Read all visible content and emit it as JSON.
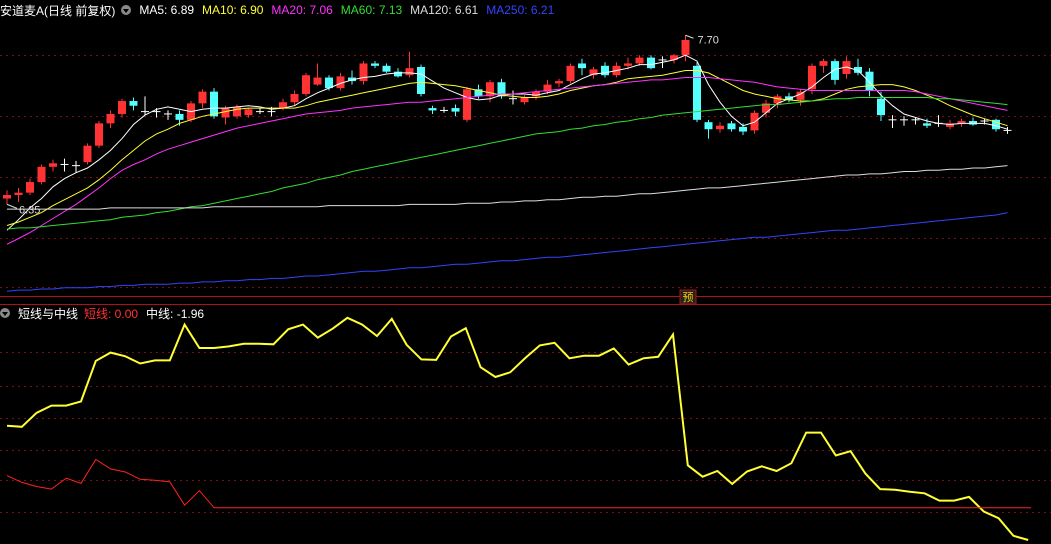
{
  "header": {
    "title": "安道麦A(日线 前复权)",
    "ma": [
      {
        "label": "MA5: 6.89",
        "color": "#ffffff"
      },
      {
        "label": "MA10: 6.90",
        "color": "#ffff33"
      },
      {
        "label": "MA20: 7.06",
        "color": "#ff33ff"
      },
      {
        "label": "MA60: 7.13",
        "color": "#33dd33"
      },
      {
        "label": "MA120: 6.61",
        "color": "#dddddd"
      },
      {
        "label": "MA250: 6.21",
        "color": "#3344ff"
      }
    ]
  },
  "indicator_header": {
    "title": "短线与中线",
    "items": [
      {
        "label": "短线: 0.00",
        "color": "#ff3333"
      },
      {
        "label": "中线: -1.96",
        "color": "#ffffff"
      }
    ]
  },
  "chart_data": [
    {
      "type": "candlestick",
      "title": "安道麦A(日线 前复权)",
      "annotations": {
        "high_label": "7.70",
        "low_label": "6.35",
        "marker": "预"
      },
      "colors": {
        "up": "#ff3333",
        "down": "#54ffff",
        "doji": "#ffffff"
      },
      "ylim": [
        5.5,
        7.85
      ],
      "candles": [
        [
          6.33,
          6.4,
          6.28,
          6.36
        ],
        [
          6.36,
          6.42,
          6.3,
          6.38
        ],
        [
          6.38,
          6.5,
          6.36,
          6.47
        ],
        [
          6.47,
          6.62,
          6.45,
          6.6
        ],
        [
          6.6,
          6.66,
          6.56,
          6.63
        ],
        [
          6.62,
          6.67,
          6.56,
          6.61
        ],
        [
          6.61,
          6.65,
          6.55,
          6.6
        ],
        [
          6.64,
          6.8,
          6.62,
          6.78
        ],
        [
          6.78,
          6.99,
          6.76,
          6.97
        ],
        [
          6.97,
          7.08,
          6.93,
          7.05
        ],
        [
          7.05,
          7.18,
          7.02,
          7.16
        ],
        [
          7.16,
          7.19,
          7.08,
          7.12
        ],
        [
          7.07,
          7.2,
          7.04,
          7.06
        ],
        [
          7.06,
          7.1,
          7.02,
          7.07
        ],
        [
          7.05,
          7.08,
          7.0,
          7.05
        ],
        [
          7.05,
          7.08,
          6.95,
          7.0
        ],
        [
          7.0,
          7.16,
          6.98,
          7.14
        ],
        [
          7.14,
          7.26,
          7.1,
          7.24
        ],
        [
          7.24,
          7.27,
          7.01,
          7.03
        ],
        [
          7.02,
          7.12,
          6.96,
          7.1
        ],
        [
          7.03,
          7.13,
          7.01,
          7.11
        ],
        [
          7.04,
          7.1,
          7.02,
          7.09
        ],
        [
          7.06,
          7.1,
          7.05,
          7.07
        ],
        [
          7.07,
          7.11,
          7.03,
          7.06
        ],
        [
          7.1,
          7.18,
          7.08,
          7.15
        ],
        [
          7.15,
          7.25,
          7.12,
          7.22
        ],
        [
          7.22,
          7.4,
          7.2,
          7.38
        ],
        [
          7.3,
          7.48,
          7.29,
          7.36
        ],
        [
          7.36,
          7.38,
          7.25,
          7.27
        ],
        [
          7.27,
          7.4,
          7.25,
          7.37
        ],
        [
          7.36,
          7.42,
          7.3,
          7.33
        ],
        [
          7.33,
          7.5,
          7.3,
          7.48
        ],
        [
          7.48,
          7.5,
          7.44,
          7.46
        ],
        [
          7.46,
          7.48,
          7.4,
          7.41
        ],
        [
          7.41,
          7.44,
          7.36,
          7.37
        ],
        [
          7.38,
          7.58,
          7.36,
          7.44
        ],
        [
          7.45,
          7.47,
          7.2,
          7.22
        ],
        [
          7.1,
          7.12,
          7.05,
          7.08
        ],
        [
          7.08,
          7.11,
          7.06,
          7.08
        ],
        [
          7.1,
          7.13,
          7.03,
          7.07
        ],
        [
          7.0,
          7.28,
          6.98,
          7.26
        ],
        [
          7.26,
          7.3,
          7.18,
          7.2
        ],
        [
          7.2,
          7.34,
          7.15,
          7.32
        ],
        [
          7.32,
          7.35,
          7.18,
          7.2
        ],
        [
          7.18,
          7.25,
          7.13,
          7.17
        ],
        [
          7.15,
          7.21,
          7.13,
          7.19
        ],
        [
          7.2,
          7.26,
          7.17,
          7.24
        ],
        [
          7.24,
          7.34,
          7.22,
          7.3
        ],
        [
          7.31,
          7.35,
          7.28,
          7.33
        ],
        [
          7.33,
          7.48,
          7.31,
          7.46
        ],
        [
          7.48,
          7.52,
          7.38,
          7.44
        ],
        [
          7.38,
          7.45,
          7.35,
          7.43
        ],
        [
          7.46,
          7.49,
          7.36,
          7.38
        ],
        [
          7.38,
          7.49,
          7.36,
          7.46
        ],
        [
          7.46,
          7.53,
          7.43,
          7.48
        ],
        [
          7.48,
          7.55,
          7.46,
          7.53
        ],
        [
          7.53,
          7.55,
          7.43,
          7.44
        ],
        [
          7.5,
          7.54,
          7.44,
          7.51
        ],
        [
          7.51,
          7.56,
          7.48,
          7.55
        ],
        [
          7.55,
          7.72,
          7.5,
          7.68
        ],
        [
          7.46,
          7.49,
          6.98,
          7.0
        ],
        [
          6.98,
          7.0,
          6.84,
          6.92
        ],
        [
          6.92,
          6.98,
          6.89,
          6.95
        ],
        [
          6.97,
          6.99,
          6.9,
          6.92
        ],
        [
          6.94,
          6.97,
          6.87,
          6.9
        ],
        [
          6.91,
          7.08,
          6.88,
          7.06
        ],
        [
          7.06,
          7.17,
          7.02,
          7.14
        ],
        [
          7.14,
          7.22,
          7.1,
          7.2
        ],
        [
          7.2,
          7.23,
          7.15,
          7.17
        ],
        [
          7.17,
          7.26,
          7.12,
          7.24
        ],
        [
          7.26,
          7.48,
          7.22,
          7.46
        ],
        [
          7.46,
          7.52,
          7.4,
          7.5
        ],
        [
          7.5,
          7.52,
          7.3,
          7.34
        ],
        [
          7.39,
          7.54,
          7.35,
          7.5
        ],
        [
          7.45,
          7.52,
          7.38,
          7.4
        ],
        [
          7.41,
          7.44,
          7.2,
          7.25
        ],
        [
          7.18,
          7.24,
          6.99,
          7.04
        ],
        [
          7.0,
          7.04,
          6.93,
          7.0
        ],
        [
          7.0,
          7.03,
          6.95,
          7.0
        ],
        [
          7.0,
          7.02,
          6.96,
          7.0
        ],
        [
          6.97,
          7.01,
          6.93,
          6.95
        ],
        [
          6.97,
          7.04,
          6.94,
          6.96
        ],
        [
          6.94,
          7.0,
          6.92,
          6.97
        ],
        [
          6.97,
          7.01,
          6.94,
          6.99
        ],
        [
          6.99,
          7.02,
          6.95,
          6.96
        ],
        [
          6.98,
          7.01,
          6.96,
          6.99
        ],
        [
          7.0,
          7.01,
          6.9,
          6.92
        ],
        [
          6.9,
          6.94,
          6.88,
          6.91
        ]
      ],
      "ma": {
        "MA5": [
          6.06,
          6.15,
          6.25,
          6.33,
          6.43,
          6.5,
          6.55,
          6.59,
          6.66,
          6.74,
          6.84,
          6.96,
          7.04,
          7.09,
          7.11,
          7.09,
          7.07,
          7.09,
          7.1,
          7.1,
          7.11,
          7.12,
          7.11,
          7.09,
          7.1,
          7.12,
          7.18,
          7.23,
          7.27,
          7.31,
          7.34,
          7.36,
          7.37,
          7.39,
          7.4,
          7.4,
          7.39,
          7.33,
          7.27,
          7.23,
          7.19,
          7.17,
          7.18,
          7.21,
          7.22,
          7.22,
          7.21,
          7.23,
          7.25,
          7.3,
          7.35,
          7.39,
          7.4,
          7.42,
          7.44,
          7.47,
          7.47,
          7.49,
          7.51,
          7.55,
          7.5,
          7.3,
          7.15,
          7.03,
          6.95,
          6.98,
          7.06,
          7.14,
          7.18,
          7.22,
          7.28,
          7.36,
          7.43,
          7.45,
          7.42,
          7.32,
          7.21,
          7.12,
          7.05,
          7.02,
          6.99,
          6.97,
          6.96,
          6.97,
          6.97,
          6.97,
          6.95,
          6.92
        ],
        "MA10": [
          6.1,
          6.13,
          6.17,
          6.21,
          6.27,
          6.32,
          6.37,
          6.42,
          6.49,
          6.57,
          6.66,
          6.74,
          6.82,
          6.88,
          6.92,
          6.97,
          7.0,
          7.03,
          7.05,
          7.07,
          7.09,
          7.1,
          7.1,
          7.1,
          7.1,
          7.1,
          7.12,
          7.15,
          7.17,
          7.19,
          7.21,
          7.23,
          7.25,
          7.27,
          7.29,
          7.31,
          7.32,
          7.31,
          7.3,
          7.29,
          7.27,
          7.25,
          7.23,
          7.21,
          7.2,
          7.19,
          7.19,
          7.2,
          7.22,
          7.25,
          7.27,
          7.29,
          7.3,
          7.32,
          7.35,
          7.36,
          7.37,
          7.38,
          7.4,
          7.42,
          7.42,
          7.4,
          7.35,
          7.3,
          7.25,
          7.22,
          7.2,
          7.18,
          7.17,
          7.16,
          7.16,
          7.18,
          7.22,
          7.26,
          7.28,
          7.29,
          7.3,
          7.3,
          7.28,
          7.25,
          7.21,
          7.17,
          7.12,
          7.08,
          7.04,
          7.01,
          6.98,
          6.95
        ],
        "MA20": [
          5.94,
          5.99,
          6.04,
          6.1,
          6.16,
          6.22,
          6.28,
          6.35,
          6.42,
          6.5,
          6.57,
          6.62,
          6.66,
          6.71,
          6.75,
          6.78,
          6.81,
          6.84,
          6.87,
          6.9,
          6.93,
          6.95,
          6.97,
          6.99,
          7.01,
          7.03,
          7.05,
          7.06,
          7.07,
          7.08,
          7.1,
          7.11,
          7.12,
          7.13,
          7.14,
          7.15,
          7.15,
          7.16,
          7.17,
          7.18,
          7.19,
          7.2,
          7.21,
          7.22,
          7.22,
          7.23,
          7.24,
          7.25,
          7.26,
          7.27,
          7.28,
          7.29,
          7.3,
          7.31,
          7.32,
          7.33,
          7.34,
          7.34,
          7.35,
          7.36,
          7.36,
          7.36,
          7.35,
          7.34,
          7.33,
          7.32,
          7.3,
          7.28,
          7.27,
          7.26,
          7.25,
          7.25,
          7.25,
          7.25,
          7.25,
          7.25,
          7.25,
          7.25,
          7.25,
          7.24,
          7.22,
          7.2,
          7.18,
          7.16,
          7.14,
          7.12,
          7.1,
          7.08
        ],
        "MA60": [
          6.07,
          6.08,
          6.08,
          6.09,
          6.1,
          6.11,
          6.12,
          6.13,
          6.14,
          6.15,
          6.17,
          6.18,
          6.19,
          6.21,
          6.22,
          6.24,
          6.26,
          6.27,
          6.29,
          6.31,
          6.33,
          6.35,
          6.37,
          6.39,
          6.42,
          6.44,
          6.46,
          6.49,
          6.51,
          6.53,
          6.56,
          6.58,
          6.6,
          6.62,
          6.64,
          6.66,
          6.68,
          6.7,
          6.72,
          6.74,
          6.76,
          6.78,
          6.8,
          6.82,
          6.84,
          6.86,
          6.88,
          6.89,
          6.9,
          6.92,
          6.93,
          6.95,
          6.96,
          6.98,
          6.99,
          7.01,
          7.02,
          7.04,
          7.05,
          7.06,
          7.07,
          7.08,
          7.09,
          7.1,
          7.11,
          7.12,
          7.13,
          7.13,
          7.14,
          7.15,
          7.16,
          7.17,
          7.18,
          7.18,
          7.19,
          7.19,
          7.19,
          7.19,
          7.19,
          7.19,
          7.19,
          7.18,
          7.18,
          7.17,
          7.16,
          7.15,
          7.14,
          7.13
        ],
        "MA120": [
          6.24,
          6.24,
          6.24,
          6.24,
          6.24,
          6.24,
          6.24,
          6.24,
          6.24,
          6.25,
          6.25,
          6.25,
          6.25,
          6.25,
          6.25,
          6.25,
          6.25,
          6.25,
          6.26,
          6.26,
          6.26,
          6.26,
          6.26,
          6.26,
          6.26,
          6.26,
          6.26,
          6.26,
          6.27,
          6.27,
          6.27,
          6.27,
          6.27,
          6.27,
          6.27,
          6.28,
          6.28,
          6.28,
          6.28,
          6.28,
          6.29,
          6.29,
          6.29,
          6.3,
          6.3,
          6.31,
          6.31,
          6.32,
          6.32,
          6.33,
          6.34,
          6.34,
          6.35,
          6.35,
          6.36,
          6.37,
          6.37,
          6.38,
          6.39,
          6.4,
          6.41,
          6.42,
          6.42,
          6.43,
          6.44,
          6.45,
          6.46,
          6.47,
          6.48,
          6.49,
          6.5,
          6.51,
          6.52,
          6.53,
          6.53,
          6.54,
          6.54,
          6.55,
          6.56,
          6.56,
          6.57,
          6.57,
          6.58,
          6.58,
          6.59,
          6.59,
          6.6,
          6.61
        ],
        "MA250": [
          5.54,
          5.55,
          5.55,
          5.56,
          5.56,
          5.57,
          5.57,
          5.57,
          5.58,
          5.58,
          5.59,
          5.59,
          5.6,
          5.6,
          5.6,
          5.61,
          5.61,
          5.62,
          5.62,
          5.63,
          5.63,
          5.64,
          5.64,
          5.65,
          5.65,
          5.66,
          5.67,
          5.67,
          5.68,
          5.69,
          5.7,
          5.71,
          5.71,
          5.72,
          5.73,
          5.74,
          5.74,
          5.75,
          5.76,
          5.77,
          5.77,
          5.78,
          5.79,
          5.8,
          5.8,
          5.81,
          5.82,
          5.83,
          5.83,
          5.84,
          5.85,
          5.86,
          5.87,
          5.88,
          5.89,
          5.9,
          5.91,
          5.92,
          5.93,
          5.94,
          5.95,
          5.96,
          5.97,
          5.98,
          5.99,
          6.0,
          6.0,
          6.01,
          6.02,
          6.03,
          6.04,
          6.05,
          6.06,
          6.06,
          6.07,
          6.08,
          6.09,
          6.1,
          6.11,
          6.12,
          6.13,
          6.14,
          6.15,
          6.16,
          6.17,
          6.18,
          6.19,
          6.21
        ]
      }
    },
    {
      "type": "line",
      "title": "短线与中线",
      "ylim": [
        -2.2,
        2.0
      ],
      "series": [
        {
          "name": "中线",
          "color": "#ffff33",
          "values": [
            0.0,
            -0.02,
            0.25,
            0.39,
            0.39,
            0.47,
            1.25,
            1.41,
            1.34,
            1.2,
            1.26,
            1.26,
            1.95,
            1.5,
            1.5,
            1.53,
            1.58,
            1.58,
            1.57,
            1.86,
            1.95,
            1.7,
            1.87,
            2.08,
            1.95,
            1.73,
            2.06,
            1.56,
            1.28,
            1.27,
            1.72,
            1.88,
            1.13,
            0.94,
            1.03,
            1.3,
            1.55,
            1.6,
            1.3,
            1.35,
            1.35,
            1.49,
            1.18,
            1.3,
            1.33,
            1.76,
            -0.76,
            -0.98,
            -0.87,
            -1.12,
            -0.88,
            -0.78,
            -0.87,
            -0.72,
            -0.13,
            -0.13,
            -0.57,
            -0.49,
            -0.92,
            -1.22,
            -1.23,
            -1.27,
            -1.3,
            -1.44,
            -1.44,
            -1.37,
            -1.65,
            -1.78,
            -2.12,
            -2.2
          ]
        },
        {
          "name": "短线",
          "color": "#ff2222",
          "values": [
            -0.96,
            -1.09,
            -1.17,
            -1.22,
            -1.01,
            -1.11,
            -0.65,
            -0.83,
            -0.89,
            -1.03,
            -1.05,
            -1.08,
            -1.53,
            -1.25,
            -1.58
          ]
        }
      ],
      "short_flat_value": -1.58
    }
  ]
}
